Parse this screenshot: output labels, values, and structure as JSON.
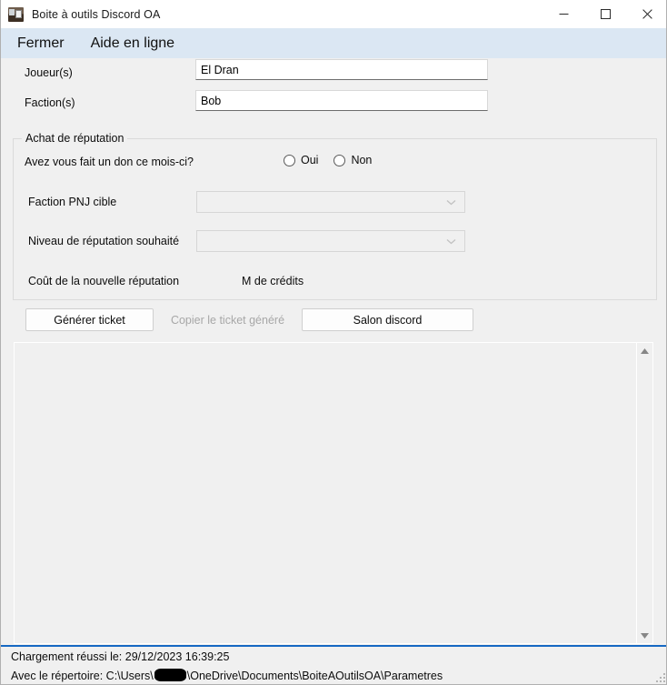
{
  "window": {
    "title": "Boite à outils Discord OA",
    "icon": "toolbox-icon",
    "caption": {
      "minimize": "minimize-icon",
      "maximize": "maximize-icon",
      "close": "close-icon"
    }
  },
  "menubar": {
    "items": [
      {
        "label": "Fermer"
      },
      {
        "label": "Aide en ligne"
      }
    ]
  },
  "form": {
    "players": {
      "label": "Joueur(s)",
      "value": "El Dran",
      "placeholder": ""
    },
    "factions": {
      "label": "Faction(s)",
      "value": "Bob",
      "placeholder": ""
    }
  },
  "reputation_group": {
    "title": "Achat de réputation",
    "donation": {
      "question": "Avez vous fait un don ce mois-ci?",
      "options": [
        {
          "label": "Oui",
          "selected": false
        },
        {
          "label": "Non",
          "selected": false
        }
      ]
    },
    "target_faction": {
      "label": "Faction PNJ cible",
      "value": "",
      "arrow": "chevron-down-icon"
    },
    "reputation_level": {
      "label": "Niveau de réputation souhaité",
      "value": "",
      "arrow": "chevron-down-icon"
    },
    "cost": {
      "label": "Coût de la nouvelle réputation",
      "value": "M de crédits"
    }
  },
  "actions": {
    "generate": {
      "label": "Générer ticket",
      "disabled": false
    },
    "copy": {
      "label": "Copier le ticket généré",
      "disabled": true
    },
    "discord": {
      "label": "Salon discord",
      "disabled": false
    }
  },
  "output": {
    "value": "",
    "scrollbar": {
      "up": "scroll-up-arrow-icon",
      "down": "scroll-down-arrow-icon"
    }
  },
  "statusbar": {
    "line1": "Chargement réussi le: 29/12/2023 16:39:25",
    "path_prefix": "Avec le répertoire: C:\\Users\\",
    "path_suffix": "\\OneDrive\\Documents\\BoiteAOutilsOA\\Parametres",
    "accent_color": "#1668c3"
  }
}
